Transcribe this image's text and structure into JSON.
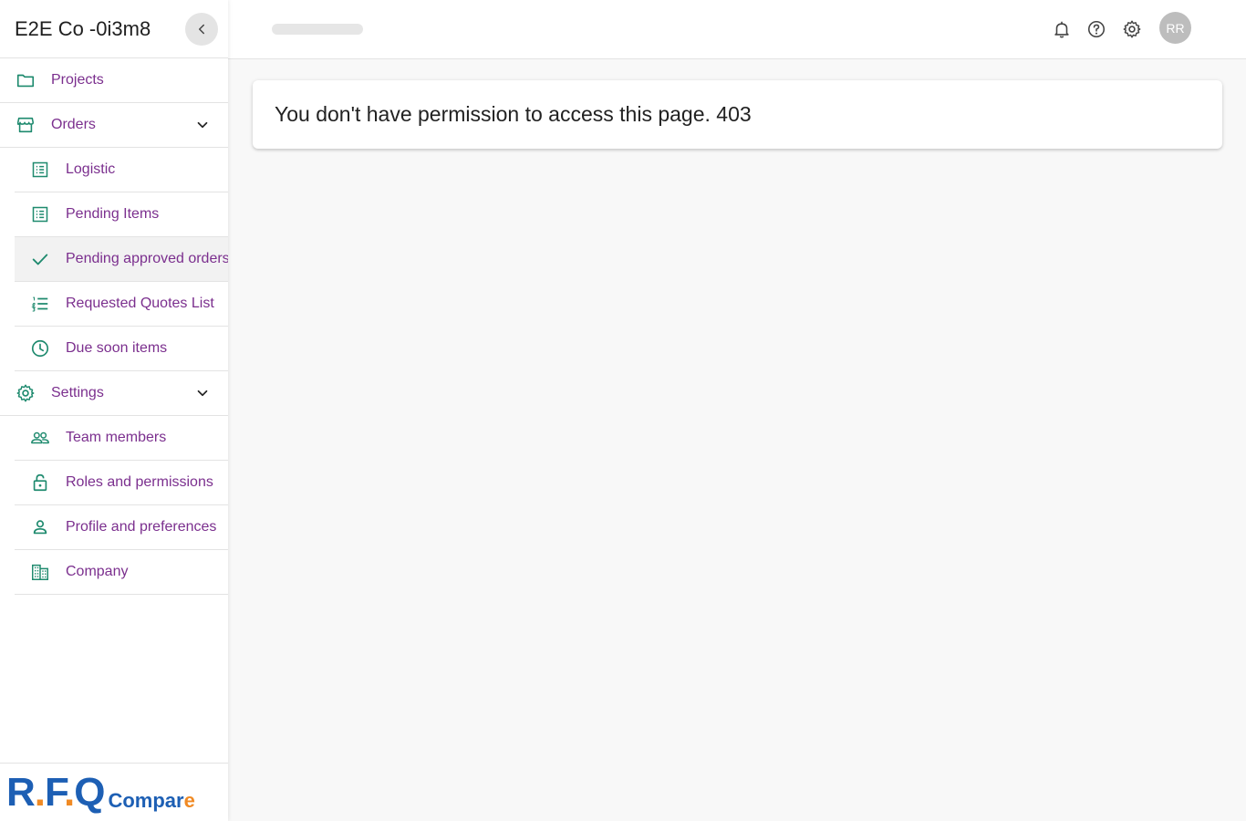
{
  "sidebar": {
    "company": "E2E Co -0i3m8",
    "items": [
      {
        "label": "Projects",
        "icon": "folder-icon"
      },
      {
        "label": "Orders",
        "icon": "store-icon"
      },
      {
        "label": "Logistic",
        "icon": "list-alt-icon"
      },
      {
        "label": "Pending Items",
        "icon": "list-alt-icon"
      },
      {
        "label": "Pending approved orders",
        "icon": "check-icon"
      },
      {
        "label": "Requested Quotes List",
        "icon": "list-numbered-icon"
      },
      {
        "label": "Due soon items",
        "icon": "clock-icon"
      },
      {
        "label": "Settings",
        "icon": "gear-icon"
      },
      {
        "label": "Team members",
        "icon": "group-icon"
      },
      {
        "label": "Roles and permissions",
        "icon": "lock-open-icon"
      },
      {
        "label": "Profile and preferences",
        "icon": "person-icon"
      },
      {
        "label": "Company",
        "icon": "building-icon"
      }
    ],
    "logo": {
      "rfq_r": "R",
      "rfq_f": "F",
      "rfq_q": "Q",
      "compare_main": "Compar",
      "compare_end": "e"
    }
  },
  "topbar": {
    "avatar_initials": "RR"
  },
  "main": {
    "error_message": "You don't have permission to access this page. 403"
  },
  "colors": {
    "accent_text": "#7b2f8e",
    "icon_green": "#1e8a6e",
    "logo_blue": "#1d5fb4",
    "logo_orange": "#f08a24"
  }
}
